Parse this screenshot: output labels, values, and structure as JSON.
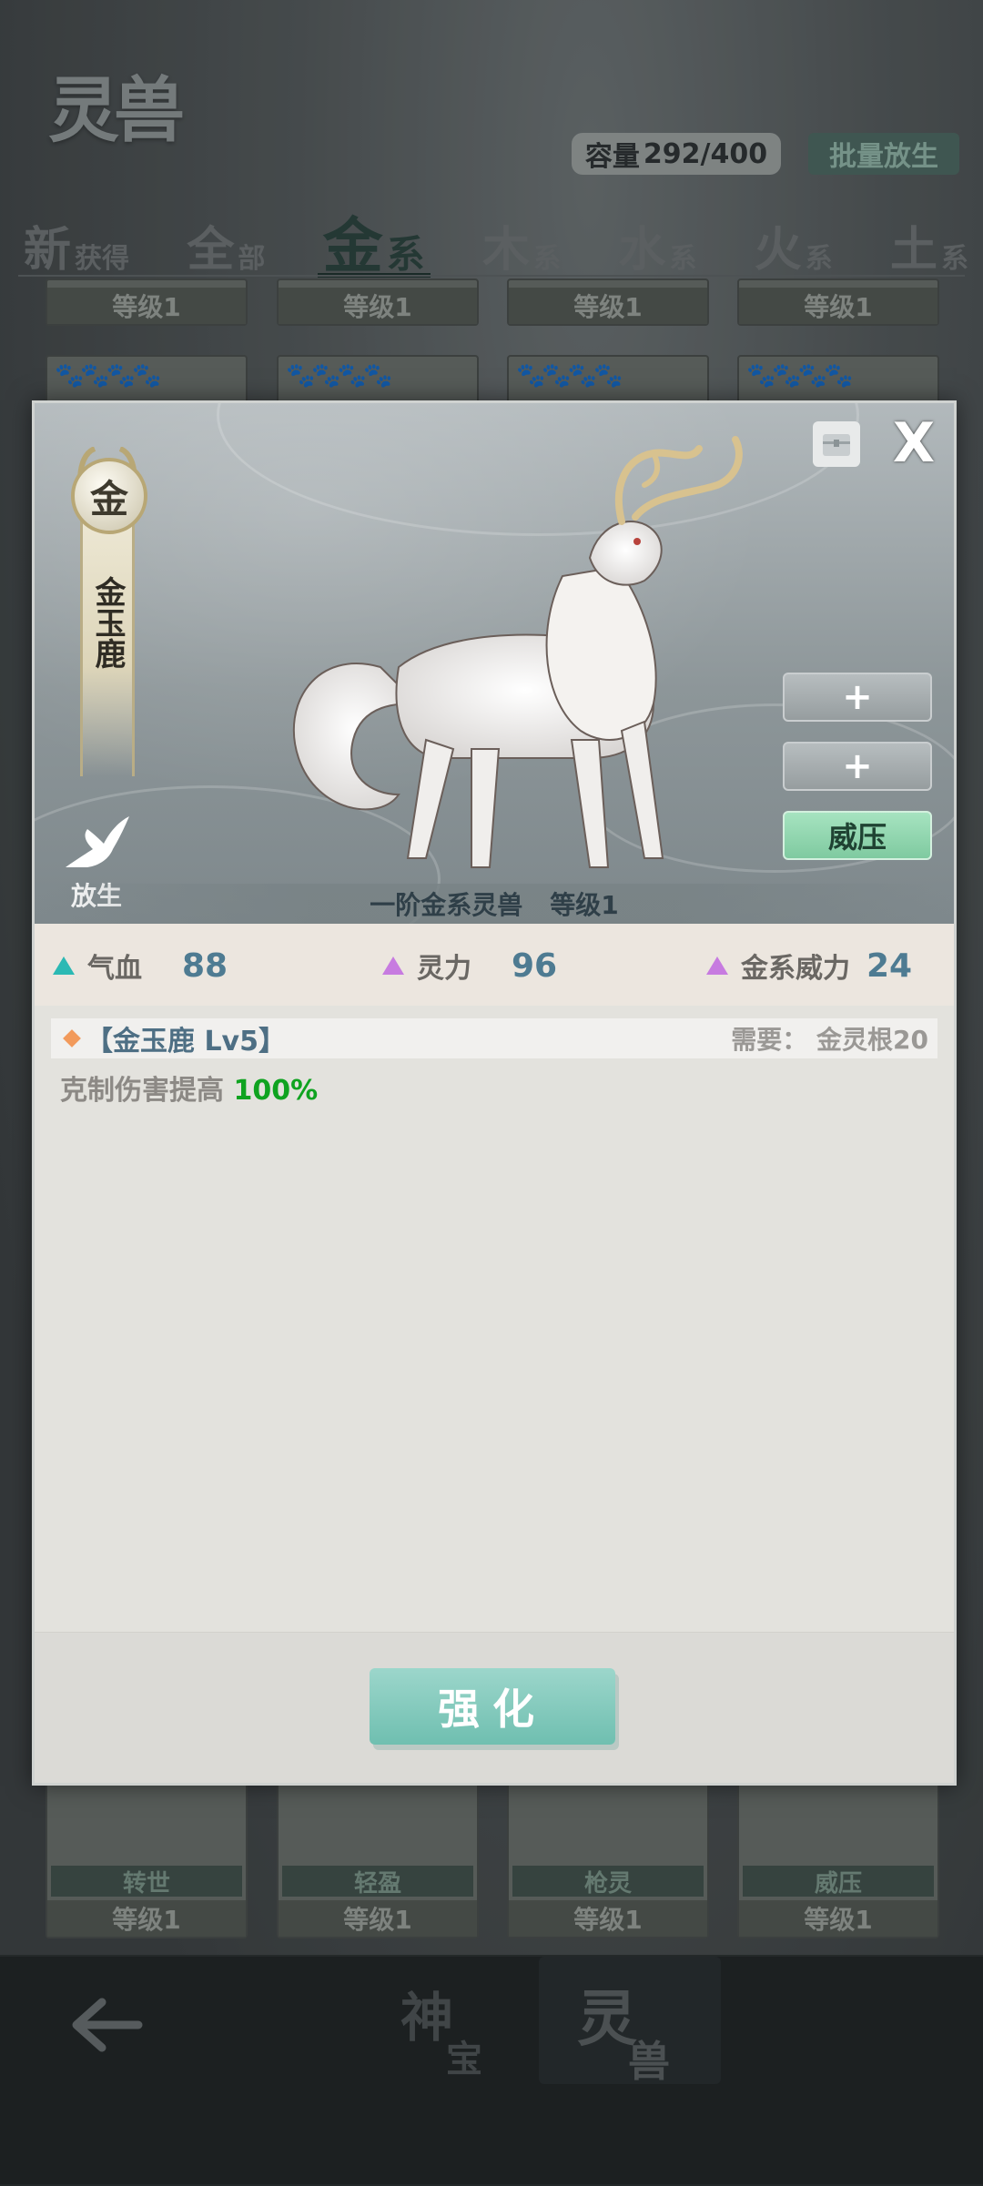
{
  "header": {
    "logo_text": "灵兽",
    "capacity_label": "容量",
    "capacity_value": "292/400",
    "release_all": "批量放生"
  },
  "tabs": [
    {
      "big": "新",
      "small": "获得"
    },
    {
      "big": "全",
      "small": "部"
    },
    {
      "big": "金",
      "small": "系"
    },
    {
      "big": "木",
      "small": "系"
    },
    {
      "big": "水",
      "small": "系"
    },
    {
      "big": "火",
      "small": "系"
    },
    {
      "big": "土",
      "small": "系"
    }
  ],
  "cards_row_top": [
    "等级1",
    "等级1",
    "等级1",
    "等级1"
  ],
  "cards_row_bottom": [
    {
      "skill": "转世",
      "level": "等级1"
    },
    {
      "skill": "轻盈",
      "level": "等级1"
    },
    {
      "skill": "枪灵",
      "level": "等级1"
    },
    {
      "skill": "威压",
      "level": "等级1"
    }
  ],
  "bottom_nav": {
    "tab1_big": "神",
    "tab1_small": "宝",
    "tab2_big": "灵",
    "tab2_small": "兽"
  },
  "modal": {
    "element": "金",
    "name": "金玉鹿",
    "release_label": "放生",
    "slot1_label": "+",
    "slot2_label": "+",
    "slot3_label": "威压",
    "close_label": "X",
    "caption_rank": "一阶金系灵兽",
    "caption_level": "等级1",
    "stats": [
      {
        "label": "气血",
        "value": "88"
      },
      {
        "label": "灵力",
        "value": "96"
      },
      {
        "label": "金系威力",
        "value": "24"
      }
    ],
    "skill": {
      "title": "【金玉鹿 Lv5】",
      "requirement": "需要：  金灵根20",
      "desc_prefix": "克制伤害提高 ",
      "desc_value": "100%"
    },
    "enhance_label": "强化"
  },
  "colors": {
    "accent_green": "#0fa320",
    "stat_value": "#4e7b92",
    "active_slot": "#7fcaa0"
  }
}
